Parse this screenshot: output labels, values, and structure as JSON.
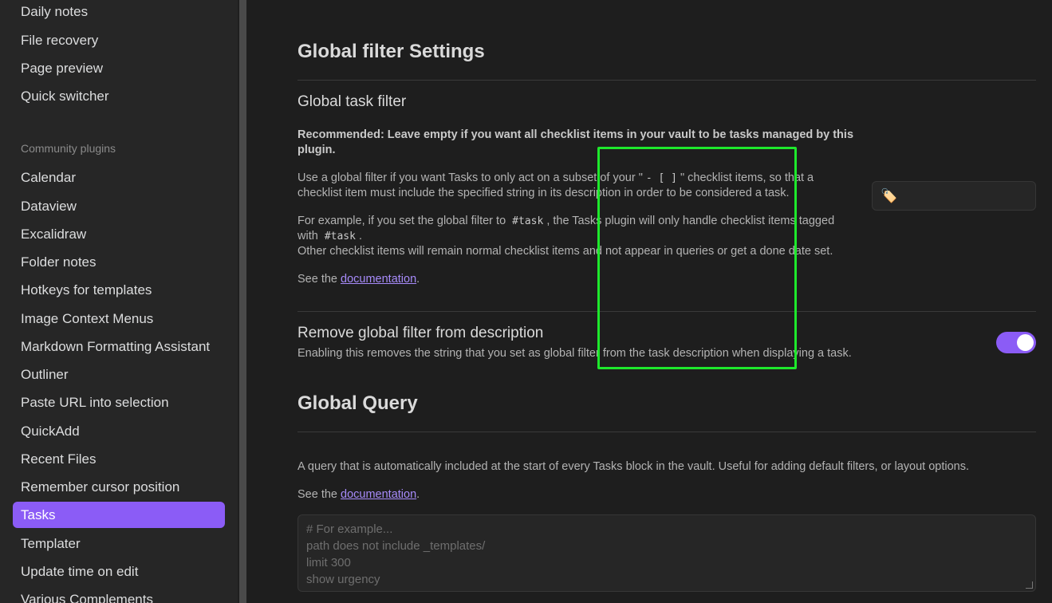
{
  "sidebar": {
    "items_top": [
      "Daily notes",
      "File recovery",
      "Page preview",
      "Quick switcher"
    ],
    "community_heading": "Community plugins",
    "items": [
      "Calendar",
      "Dataview",
      "Excalidraw",
      "Folder notes",
      "Hotkeys for templates",
      "Image Context Menus",
      "Markdown Formatting Assistant",
      "Outliner",
      "Paste URL into selection",
      "QuickAdd",
      "Recent Files",
      "Remember cursor position",
      "Tasks",
      "Templater",
      "Update time on edit",
      "Various Complements"
    ],
    "active": "Tasks"
  },
  "global_filter": {
    "heading": "Global filter Settings",
    "name": "Global task filter",
    "recommended": "Recommended: Leave empty if you want all checklist items in your vault to be tasks managed by this",
    "recommended_2": "plugin.",
    "use_1": "Use a global filter if you want Tasks to only act on a subset of your \"",
    "use_code": "- [ ]",
    "use_2": "\" checklist items, so that a",
    "use_3": "checklist item must include the specified string in its description in order to be considered a task.",
    "example_1": "For example, if you set the global filter to",
    "example_code": "#task",
    "example_2": ", the Tasks plugin will only handle checklist items tagged",
    "example_3": "with",
    "example_code_2": "#task",
    "example_4": ".",
    "other": "Other checklist items will remain normal checklist items and not appear in queries or get a done date set.",
    "see": "See the",
    "doc_link": "documentation",
    "period": ".",
    "input_value": "🏷️"
  },
  "remove_filter": {
    "name": "Remove global filter from description",
    "desc": "Enabling this removes the string that you set as global filter from the task description when displaying a task.",
    "enabled": true
  },
  "global_query": {
    "heading": "Global Query",
    "desc": "A query that is automatically included at the start of every Tasks block in the vault. Useful for adding default filters, or layout options.",
    "see": "See the",
    "doc_link": "documentation",
    "period": ".",
    "placeholder": "# For example...\npath does not include _templates/\nlimit 300\nshow urgency"
  },
  "colors": {
    "accent": "#8b5cf6",
    "highlight": "#1ee82c"
  }
}
